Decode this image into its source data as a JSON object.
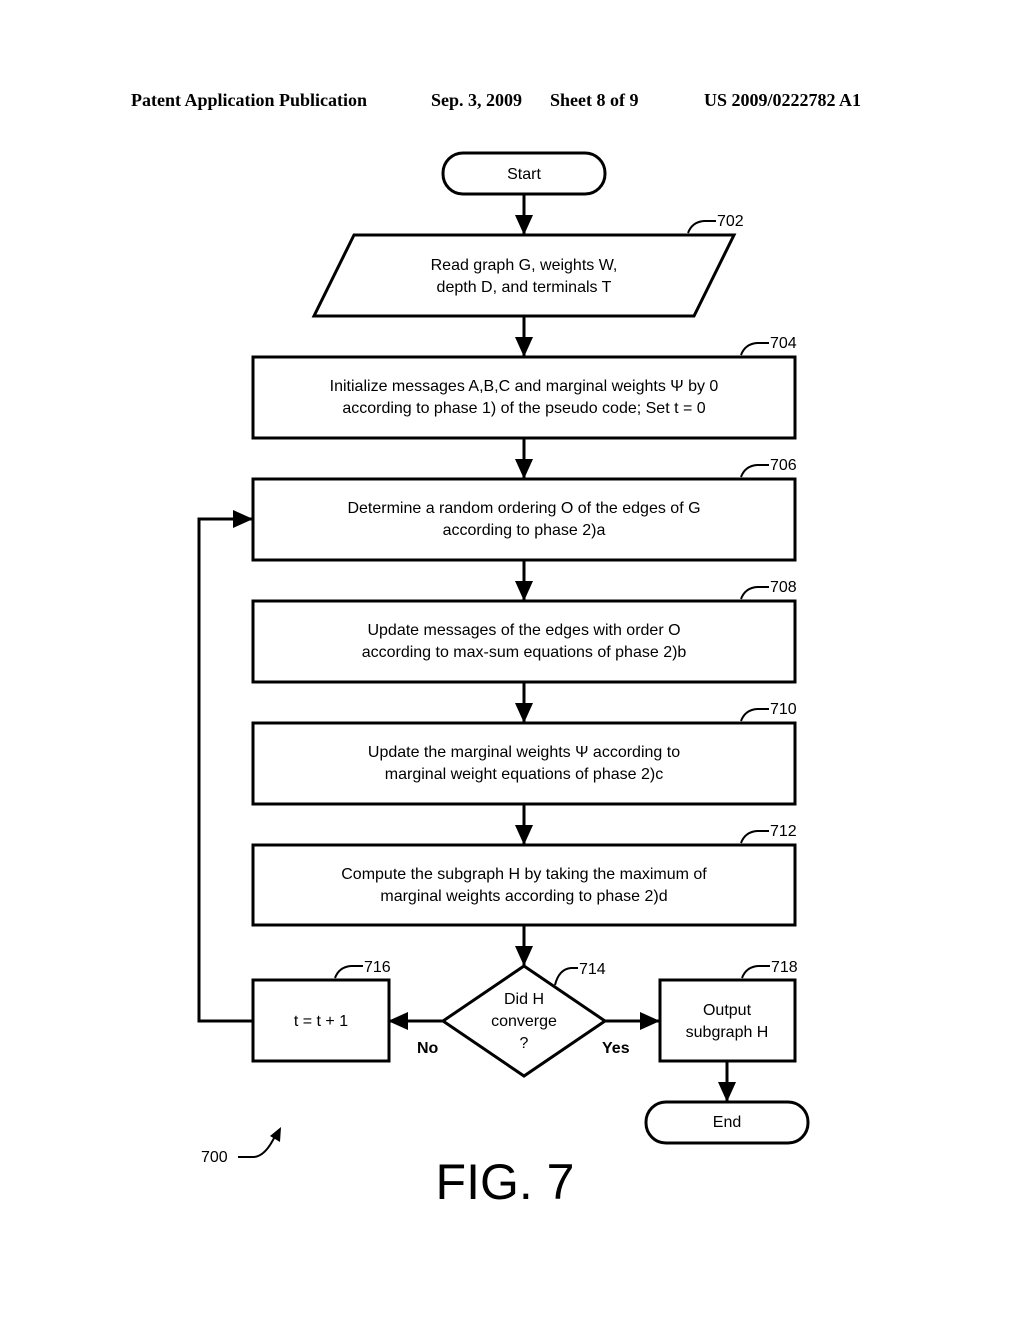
{
  "header": {
    "publication": "Patent Application Publication",
    "date": "Sep. 3, 2009",
    "sheet": "Sheet 8 of 9",
    "number": "US 2009/0222782 A1"
  },
  "flowchart": {
    "start": "Start",
    "end": "End",
    "steps": {
      "702": {
        "ref": "702",
        "line1": "Read graph G, weights W,",
        "line2": "depth D, and terminals T"
      },
      "704": {
        "ref": "704",
        "line1": "Initialize messages A,B,C and marginal weights Ψ by 0",
        "line2": "according to phase 1) of the pseudo code; Set  t = 0"
      },
      "706": {
        "ref": "706",
        "line1": "Determine a random ordering O of the edges of G",
        "line2": "according to phase 2)a"
      },
      "708": {
        "ref": "708",
        "line1": "Update messages of the edges with order O",
        "line2": "according to max-sum equations of phase 2)b"
      },
      "710": {
        "ref": "710",
        "line1": "Update the marginal weights Ψ according to",
        "line2": "marginal weight equations of phase 2)c"
      },
      "712": {
        "ref": "712",
        "line1": "Compute the subgraph H by taking the maximum of",
        "line2": "marginal weights according to phase 2)d"
      },
      "714": {
        "ref": "714",
        "line1": "Did H",
        "line2": "converge",
        "line3": "?"
      },
      "716": {
        "ref": "716",
        "line1": "t = t + 1"
      },
      "718": {
        "ref": "718",
        "line1": "Output",
        "line2": "subgraph H"
      }
    },
    "branch_no": "No",
    "branch_yes": "Yes",
    "figure_ref": "700",
    "figure_label": "FIG. 7"
  }
}
